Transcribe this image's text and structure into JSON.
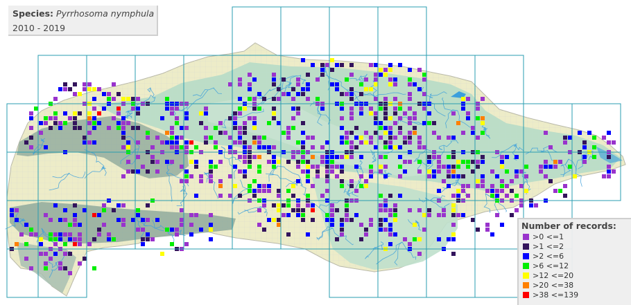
{
  "header": {
    "species_label": "Species:",
    "species_name": "Pyrrhosoma nymphula",
    "date_range": "2010 - 2019"
  },
  "legend": {
    "title": "Number of records:",
    "items": [
      {
        "label": ">0 <=1",
        "color": "#9933cc"
      },
      {
        "label": ">1 <=2",
        "color": "#33145c"
      },
      {
        "label": ">2 <=6",
        "color": "#0000ff"
      },
      {
        "label": ">6 <=12",
        "color": "#00ee00"
      },
      {
        "label": ">12 <=20",
        "color": "#ffff00"
      },
      {
        "label": ">20 <=38",
        "color": "#ff8000"
      },
      {
        "label": ">38 <=139",
        "color": "#ff0000"
      }
    ]
  },
  "colors": {
    "grid_line": "#2a9db0",
    "sea": "#ffffff",
    "land_light": "#edecc8",
    "land_green": "#b9dcc7",
    "land_grey": "#8faa9c",
    "river": "#3b9fdc"
  }
}
